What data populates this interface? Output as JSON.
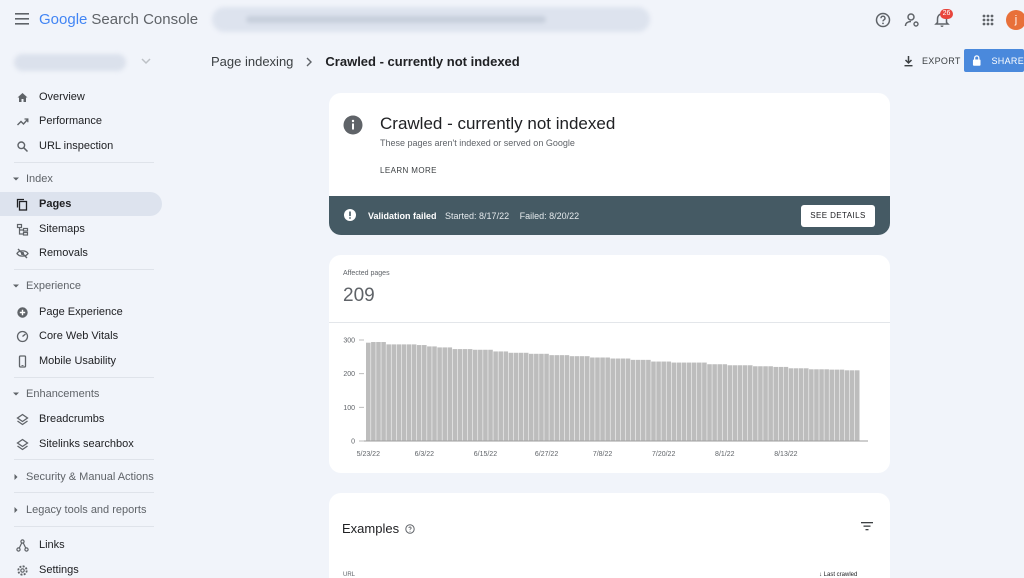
{
  "app": {
    "brand": "Google",
    "product": "Search Console"
  },
  "header": {
    "notification_count": "26",
    "avatar_initial": "j"
  },
  "sidebar": {
    "top_items": [
      {
        "label": "Overview",
        "icon": "home-icon"
      },
      {
        "label": "Performance",
        "icon": "trending-up-icon"
      },
      {
        "label": "URL inspection",
        "icon": "search-icon"
      }
    ],
    "sections": [
      {
        "label": "Index",
        "items": [
          {
            "label": "Pages",
            "icon": "pages-icon",
            "active": true
          },
          {
            "label": "Sitemaps",
            "icon": "sitemap-icon"
          },
          {
            "label": "Removals",
            "icon": "eye-off-icon"
          }
        ]
      },
      {
        "label": "Experience",
        "items": [
          {
            "label": "Page Experience",
            "icon": "plus-circle-icon"
          },
          {
            "label": "Core Web Vitals",
            "icon": "gauge-icon"
          },
          {
            "label": "Mobile Usability",
            "icon": "phone-icon"
          }
        ]
      },
      {
        "label": "Enhancements",
        "items": [
          {
            "label": "Breadcrumbs",
            "icon": "layers-icon"
          },
          {
            "label": "Sitelinks searchbox",
            "icon": "layers-icon"
          }
        ]
      },
      {
        "label": "Security & Manual Actions"
      },
      {
        "label": "Legacy tools and reports"
      }
    ],
    "bottom_items": [
      {
        "label": "Links",
        "icon": "links-icon"
      },
      {
        "label": "Settings",
        "icon": "settings-icon"
      }
    ]
  },
  "breadcrumb": {
    "parent": "Page indexing",
    "current": "Crawled - currently not indexed"
  },
  "toolbar": {
    "export_label": "EXPORT",
    "share_label": "SHARE"
  },
  "status": {
    "title": "Crawled - currently not indexed",
    "subtitle": "These pages aren't indexed or served on Google",
    "learn_more": "LEARN MORE",
    "validation_label": "Validation failed",
    "started": "Started: 8/17/22",
    "failed": "Failed: 8/20/22",
    "see_details": "SEE DETAILS"
  },
  "affected": {
    "label": "Affected pages",
    "value": "209"
  },
  "examples": {
    "title": "Examples",
    "col_url": "URL",
    "col_last_crawled": "Last crawled"
  },
  "colors": {
    "accent": "#4a89dc",
    "banner": "#455a64",
    "bar": "#bdbdbd",
    "background": "#f1f4fa"
  },
  "chart_data": {
    "type": "bar",
    "ylim": [
      0,
      300
    ],
    "yticks": [
      "0",
      "100",
      "200",
      "300"
    ],
    "xticks": [
      "5/23/22",
      "6/3/22",
      "6/15/22",
      "6/27/22",
      "7/8/22",
      "7/20/22",
      "8/1/22",
      "8/13/22"
    ],
    "xtick_index": [
      0,
      11,
      23,
      35,
      46,
      58,
      70,
      82
    ],
    "grid": false,
    "series": [
      {
        "values": [
          292,
          294,
          294,
          294,
          287,
          287,
          287,
          287,
          287,
          287,
          285,
          285,
          281,
          281,
          278,
          278,
          278,
          273,
          273,
          273,
          273,
          271,
          271,
          271,
          271,
          266,
          266,
          266,
          262,
          262,
          262,
          262,
          259,
          259,
          259,
          259,
          255,
          255,
          255,
          255,
          252,
          252,
          252,
          252,
          248,
          248,
          248,
          248,
          245,
          245,
          245,
          245,
          241,
          241,
          241,
          241,
          236,
          236,
          236,
          236,
          233,
          233,
          233,
          233,
          233,
          233,
          233,
          228,
          228,
          228,
          228,
          225,
          225,
          225,
          225,
          225,
          222,
          222,
          222,
          222,
          220,
          220,
          220,
          216,
          216,
          216,
          216,
          213,
          213,
          213,
          213,
          212,
          212,
          212,
          210,
          210,
          210
        ]
      }
    ]
  }
}
